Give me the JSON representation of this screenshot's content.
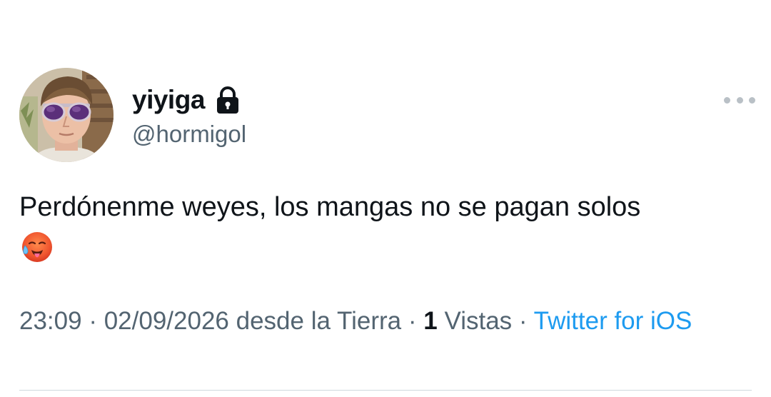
{
  "user": {
    "display_name": "yiyiga",
    "handle": "@hormigol",
    "protected_icon": "lock-icon",
    "avatar_icon": "avatar-photo"
  },
  "more_icon": "more-horizontal-icon",
  "tweet": {
    "text": "Perdónenme weyes, los mangas no se pagan solos",
    "emoji": "hot-face-emoji"
  },
  "meta": {
    "time": "23:09",
    "date": "02/09/2026",
    "location": "desde la Tierra",
    "sep": "·",
    "views_count": "1",
    "views_label": "Vistas",
    "source": "Twitter for iOS"
  },
  "colors": {
    "text": "#0f1419",
    "secondary": "#536471",
    "link": "#1d9bf0",
    "divider": "#cfd9de"
  }
}
